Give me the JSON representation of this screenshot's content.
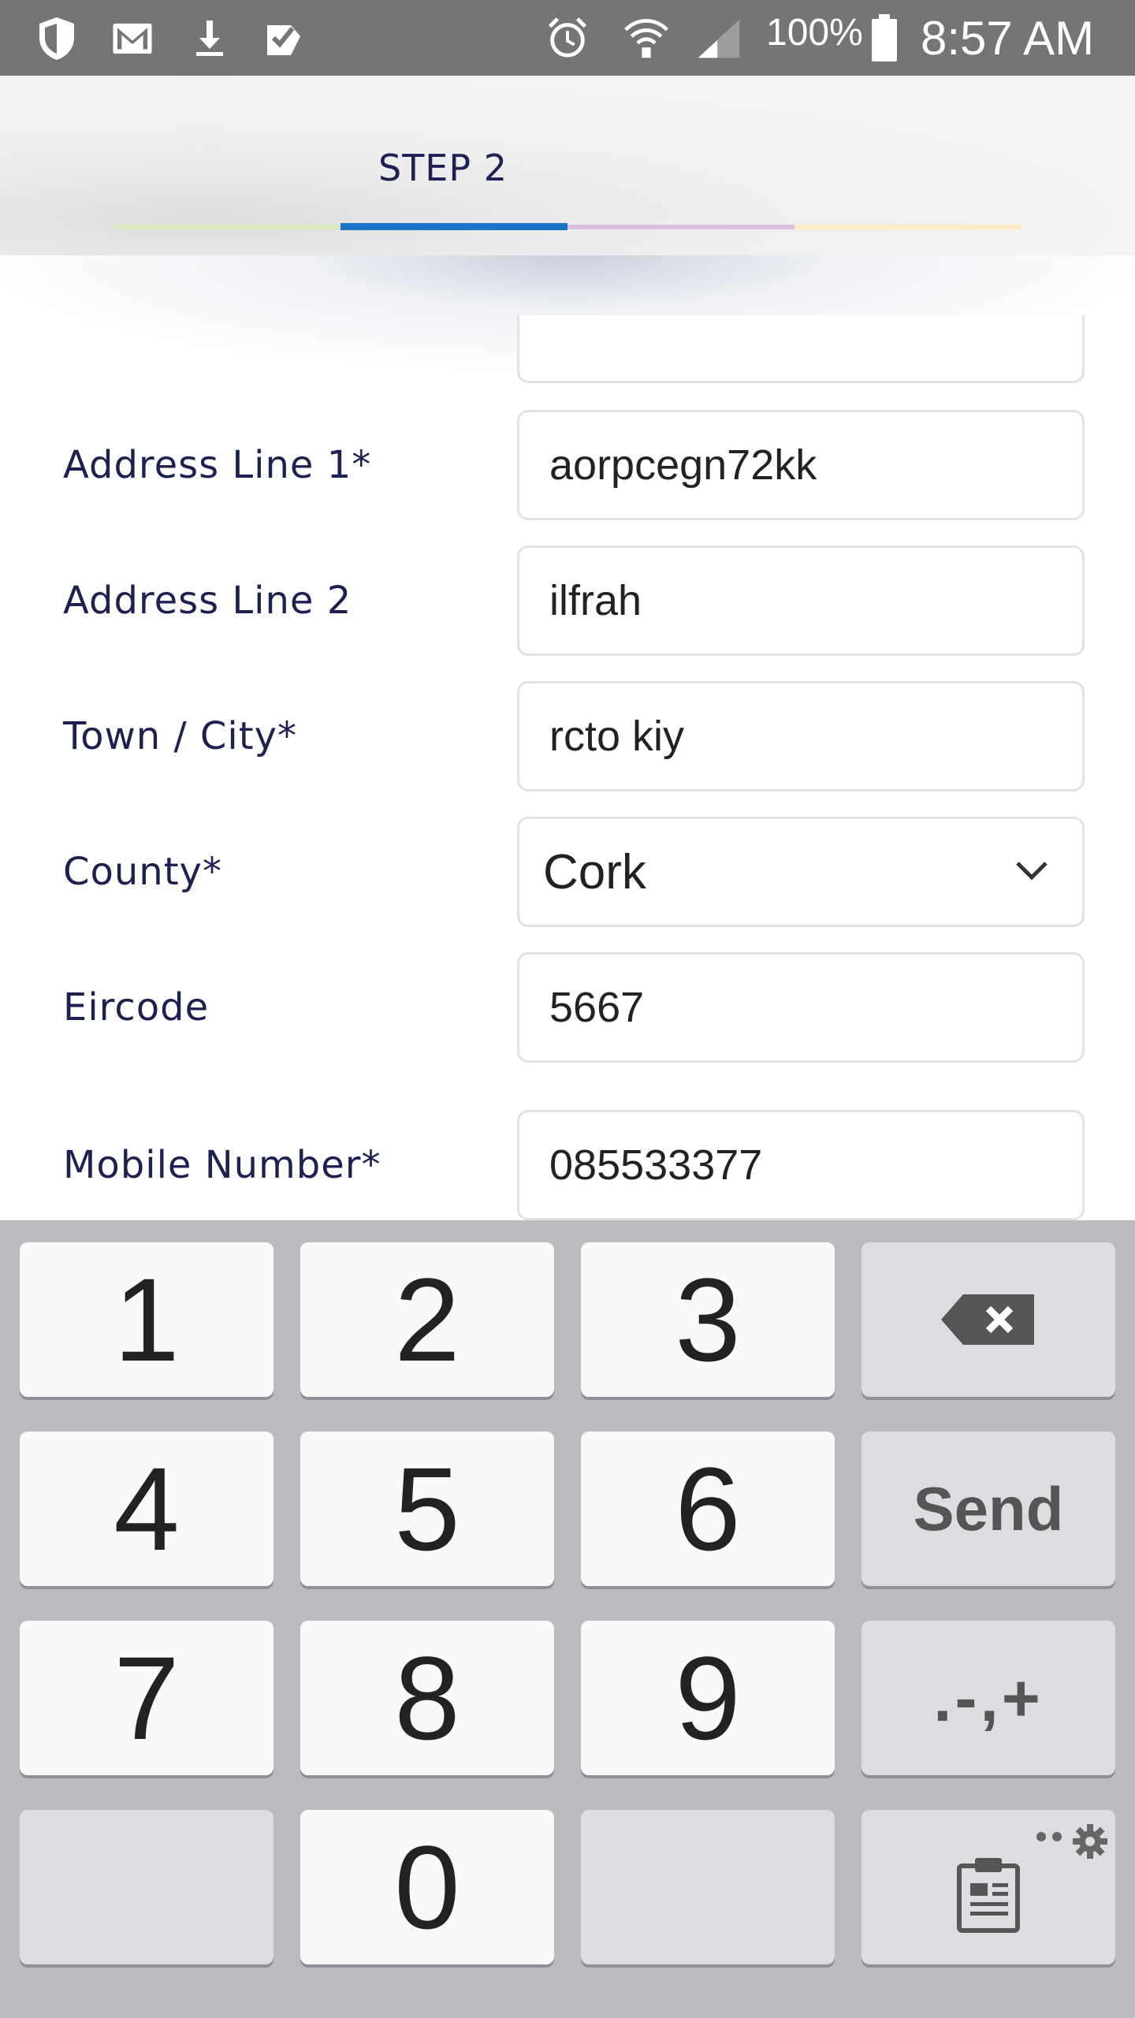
{
  "status_bar": {
    "battery": "100%",
    "time": "8:57 AM",
    "icons": [
      "shield-icon",
      "gmail-icon",
      "download-icon",
      "task-check-icon",
      "alarm-icon",
      "wifi-icon",
      "signal-icon",
      "battery-icon"
    ]
  },
  "header": {
    "step_label": "STEP 2",
    "progress_colors": [
      "#d6ebc4",
      "#1a73c4",
      "#dcc0df",
      "#fbeec0"
    ]
  },
  "form": {
    "fields": [
      {
        "label": "Address Line 1*",
        "value": "aorpcegn72kk"
      },
      {
        "label": "Address Line 2",
        "value": "ilfrah"
      },
      {
        "label": "Town / City*",
        "value": "rcto kiy"
      },
      {
        "label": "County*",
        "value": "Cork"
      },
      {
        "label": "Eircode",
        "value": "5667"
      },
      {
        "label": "Mobile Number*",
        "value": "085533377"
      }
    ]
  },
  "keyboard": {
    "keys": [
      "1",
      "2",
      "3",
      "4",
      "5",
      "6",
      "7",
      "8",
      "9",
      "0"
    ],
    "send_label": "Send",
    "symbols_label": ".-,+"
  },
  "colors": {
    "status_bar": "#757575",
    "label_text": "#1c2152",
    "keyboard_bg": "#b9bbbf"
  }
}
